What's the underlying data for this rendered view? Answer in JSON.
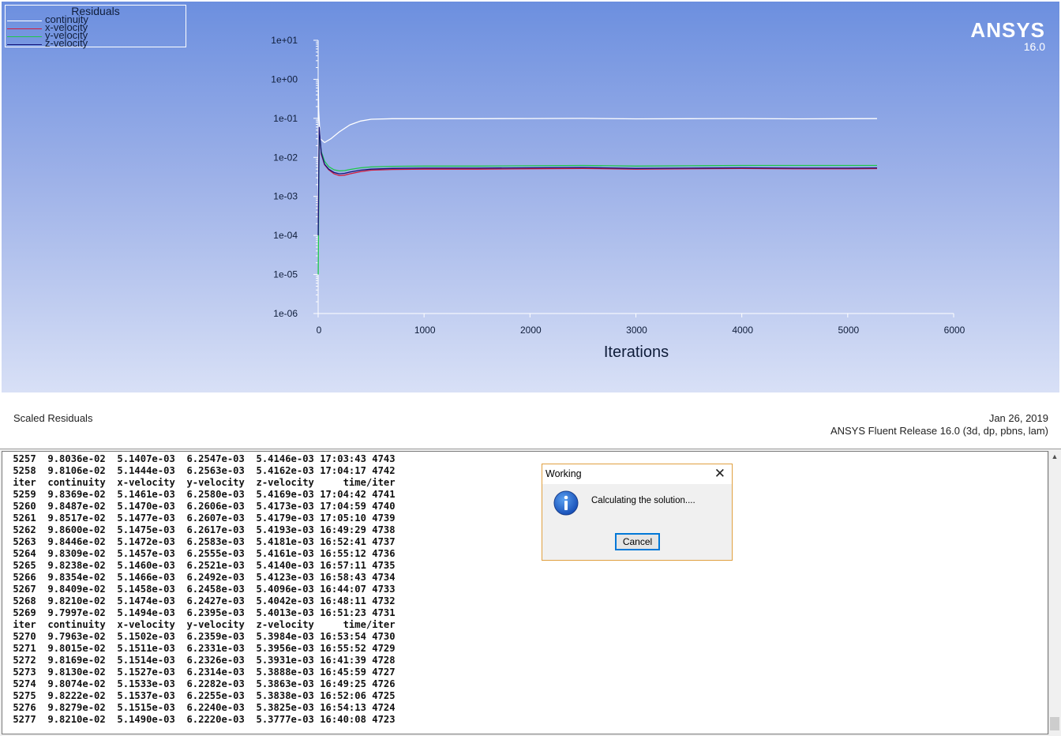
{
  "graphics": {
    "legend": {
      "title": "Residuals",
      "series": [
        {
          "label": "continuity",
          "color": "#ffffff"
        },
        {
          "label": "x-velocity",
          "color": "#d21c3c"
        },
        {
          "label": "y-velocity",
          "color": "#1ec84a"
        },
        {
          "label": "z-velocity",
          "color": "#14147a"
        }
      ]
    },
    "logo": {
      "name": "ANSYS",
      "version": "16.0"
    },
    "footer_left": "Scaled Residuals",
    "footer_date": "Jan 26, 2019",
    "footer_release": "ANSYS Fluent Release 16.0 (3d, dp, pbns, lam)"
  },
  "chart_data": {
    "type": "line",
    "title": "",
    "xlabel": "Iterations",
    "ylabel": "",
    "xlim": [
      0,
      6000
    ],
    "ylim": [
      1e-06,
      10
    ],
    "yscale": "log",
    "x_ticks": [
      "0",
      "1000",
      "2000",
      "3000",
      "4000",
      "5000",
      "6000"
    ],
    "y_ticks": [
      "1e-06",
      "1e-05",
      "1e-04",
      "1e-03",
      "1e-02",
      "1e-01",
      "1e+00",
      "1e+01"
    ],
    "grid": false,
    "legend_position": "top-left",
    "series": [
      {
        "name": "continuity",
        "color": "#ffffff",
        "x": [
          1,
          5,
          20,
          60,
          120,
          200,
          300,
          400,
          500,
          700,
          1000,
          1500,
          2000,
          2500,
          3000,
          3500,
          4000,
          4500,
          5000,
          5277
        ],
        "y": [
          1.0,
          0.15,
          0.03,
          0.024,
          0.03,
          0.045,
          0.068,
          0.085,
          0.095,
          0.098,
          0.098,
          0.098,
          0.099,
          0.1,
          0.097,
          0.098,
          0.099,
          0.097,
          0.098,
          0.0982
        ]
      },
      {
        "name": "x-velocity",
        "color": "#d21c3c",
        "x": [
          1,
          10,
          30,
          60,
          100,
          150,
          200,
          250,
          300,
          400,
          500,
          700,
          1000,
          1500,
          2000,
          2500,
          3000,
          3500,
          4000,
          4500,
          5000,
          5277
        ],
        "y": [
          0.0001,
          0.05,
          0.012,
          0.0065,
          0.0048,
          0.0038,
          0.0034,
          0.0035,
          0.0038,
          0.0043,
          0.0047,
          0.0049,
          0.005,
          0.005,
          0.0051,
          0.0052,
          0.005,
          0.0051,
          0.0052,
          0.0051,
          0.0051,
          0.00515
        ]
      },
      {
        "name": "y-velocity",
        "color": "#1ec84a",
        "x": [
          1,
          10,
          30,
          60,
          100,
          150,
          200,
          250,
          300,
          400,
          500,
          700,
          1000,
          1500,
          2000,
          2500,
          3000,
          3500,
          4000,
          4500,
          5000,
          5277
        ],
        "y": [
          1e-05,
          0.04,
          0.014,
          0.008,
          0.0058,
          0.0048,
          0.0045,
          0.0046,
          0.0049,
          0.0054,
          0.0057,
          0.0059,
          0.006,
          0.006,
          0.0061,
          0.0062,
          0.006,
          0.0061,
          0.0062,
          0.0062,
          0.0062,
          0.00622
        ]
      },
      {
        "name": "z-velocity",
        "color": "#14147a",
        "x": [
          1,
          10,
          30,
          60,
          100,
          150,
          200,
          250,
          300,
          400,
          500,
          700,
          1000,
          1500,
          2000,
          2500,
          3000,
          3500,
          4000,
          4500,
          5000,
          5277
        ],
        "y": [
          0.0001,
          0.06,
          0.013,
          0.0067,
          0.005,
          0.0041,
          0.0038,
          0.0039,
          0.0042,
          0.0047,
          0.005,
          0.0052,
          0.0053,
          0.0053,
          0.0054,
          0.0055,
          0.0052,
          0.0053,
          0.0054,
          0.0053,
          0.0053,
          0.00538
        ]
      }
    ]
  },
  "console": {
    "lines": [
      " 5257  9.8036e-02  5.1407e-03  6.2547e-03  5.4146e-03 17:03:43 4743",
      " 5258  9.8106e-02  5.1444e-03  6.2563e-03  5.4162e-03 17:04:17 4742",
      " iter  continuity  x-velocity  y-velocity  z-velocity     time/iter",
      " 5259  9.8369e-02  5.1461e-03  6.2580e-03  5.4169e-03 17:04:42 4741",
      " 5260  9.8487e-02  5.1470e-03  6.2606e-03  5.4173e-03 17:04:59 4740",
      " 5261  9.8517e-02  5.1477e-03  6.2607e-03  5.4179e-03 17:05:10 4739",
      " 5262  9.8600e-02  5.1475e-03  6.2617e-03  5.4193e-03 16:49:29 4738",
      " 5263  9.8446e-02  5.1472e-03  6.2583e-03  5.4181e-03 16:52:41 4737",
      " 5264  9.8309e-02  5.1457e-03  6.2555e-03  5.4161e-03 16:55:12 4736",
      " 5265  9.8238e-02  5.1460e-03  6.2521e-03  5.4140e-03 16:57:11 4735",
      " 5266  9.8354e-02  5.1466e-03  6.2492e-03  5.4123e-03 16:58:43 4734",
      " 5267  9.8409e-02  5.1458e-03  6.2458e-03  5.4096e-03 16:44:07 4733",
      " 5268  9.8210e-02  5.1474e-03  6.2427e-03  5.4042e-03 16:48:11 4732",
      " 5269  9.7997e-02  5.1494e-03  6.2395e-03  5.4013e-03 16:51:23 4731",
      " iter  continuity  x-velocity  y-velocity  z-velocity     time/iter",
      " 5270  9.7963e-02  5.1502e-03  6.2359e-03  5.3984e-03 16:53:54 4730",
      " 5271  9.8015e-02  5.1511e-03  6.2331e-03  5.3956e-03 16:55:52 4729",
      " 5272  9.8169e-02  5.1514e-03  6.2326e-03  5.3931e-03 16:41:39 4728",
      " 5273  9.8130e-02  5.1527e-03  6.2314e-03  5.3888e-03 16:45:59 4727",
      " 5274  9.8074e-02  5.1533e-03  6.2282e-03  5.3863e-03 16:49:25 4726",
      " 5275  9.8222e-02  5.1537e-03  6.2255e-03  5.3838e-03 16:52:06 4725",
      " 5276  9.8279e-02  5.1515e-03  6.2240e-03  5.3825e-03 16:54:13 4724",
      " 5277  9.8210e-02  5.1490e-03  6.2220e-03  5.3777e-03 16:40:08 4723"
    ]
  },
  "dialog": {
    "title": "Working",
    "message": "Calculating the solution....",
    "cancel_label": "Cancel",
    "close_glyph": "✕",
    "icon": "info-icon"
  },
  "scrollbar": {
    "up_glyph": "▲"
  }
}
